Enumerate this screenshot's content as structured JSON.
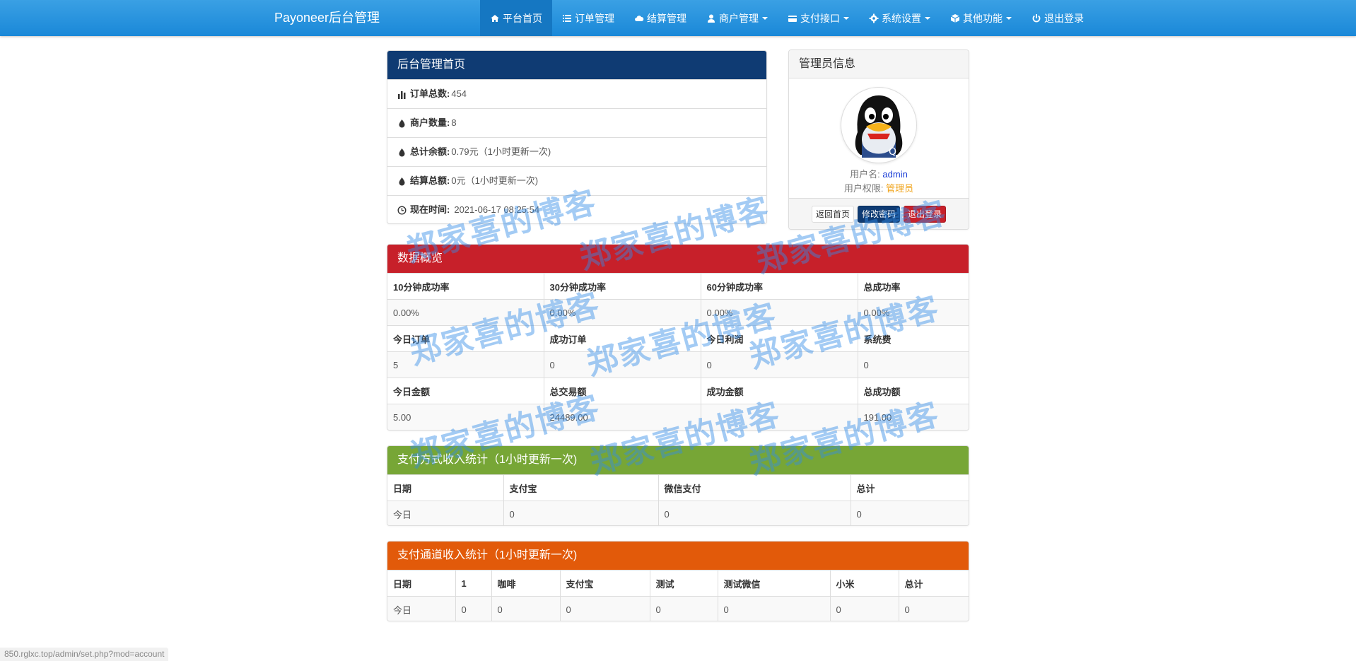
{
  "navbar": {
    "brand": "Payoneer后台管理",
    "items": [
      {
        "label": "平台首页",
        "icon": "home-icon",
        "dropdown": false,
        "active": true
      },
      {
        "label": "订单管理",
        "icon": "list-icon",
        "dropdown": false,
        "active": false
      },
      {
        "label": "结算管理",
        "icon": "cloud-icon",
        "dropdown": false,
        "active": false
      },
      {
        "label": "商户管理",
        "icon": "user-icon",
        "dropdown": true,
        "active": false
      },
      {
        "label": "支付接口",
        "icon": "credit-card-icon",
        "dropdown": true,
        "active": false
      },
      {
        "label": "系统设置",
        "icon": "gear-icon",
        "dropdown": true,
        "active": false
      },
      {
        "label": "其他功能",
        "icon": "cube-icon",
        "dropdown": true,
        "active": false
      },
      {
        "label": "退出登录",
        "icon": "power-icon",
        "dropdown": false,
        "active": false
      }
    ]
  },
  "home_panel": {
    "title": "后台管理首页",
    "rows": [
      {
        "icon": "bar-chart-icon",
        "label": "订单总数:",
        "value": "454"
      },
      {
        "icon": "drop-icon",
        "label": "商户数量:",
        "value": "8"
      },
      {
        "icon": "drop-icon",
        "label": "总计余额:",
        "value": "0.79元（1小时更新一次)"
      },
      {
        "icon": "drop-icon",
        "label": "结算总额:",
        "value": "0元（1小时更新一次)"
      },
      {
        "icon": "clock-icon",
        "label": "现在时间:",
        "value": "2021-06-17 08:25:54"
      }
    ]
  },
  "admin_panel": {
    "title": "管理员信息",
    "username_label": "用户名:",
    "username": "admin",
    "role_label": "用户权限:",
    "role": "管理员",
    "buttons": {
      "home": "返回首页",
      "change_password": "修改密码",
      "logout": "退出登录"
    }
  },
  "overview_panel": {
    "title": "数据概览",
    "rows": [
      {
        "headers": [
          "10分钟成功率",
          "30分钟成功率",
          "60分钟成功率",
          "总成功率"
        ],
        "values": [
          "0.00%",
          "0.00%",
          "0.00%",
          "0.00%"
        ]
      },
      {
        "headers": [
          "今日订单",
          "成功订单",
          "今日利润",
          "系统费"
        ],
        "values": [
          "5",
          "0",
          "0",
          "0"
        ]
      },
      {
        "headers": [
          "今日金额",
          "总交易额",
          "成功金额",
          "总成功额"
        ],
        "values": [
          "5.00",
          "24489.00",
          "",
          "191.00"
        ]
      }
    ]
  },
  "paymethod_panel": {
    "title": "支付方式收入统计（1小时更新一次)",
    "headers": [
      "日期",
      "支付宝",
      "微信支付",
      "总计"
    ],
    "values": [
      "今日",
      "0",
      "0",
      "0"
    ]
  },
  "channel_panel": {
    "title": "支付通道收入统计（1小时更新一次)",
    "headers": [
      "日期",
      "1",
      "咖啡",
      "支付宝",
      "测试",
      "测试微信",
      "小米",
      "总计"
    ],
    "values": [
      "今日",
      "0",
      "0",
      "0",
      "0",
      "0",
      "0",
      "0"
    ]
  },
  "watermark_text": "郑家喜的博客",
  "status_bar": "850.rglxc.top/admin/set.php?mod=account",
  "colors": {
    "navbar": "#1a88d8",
    "home_heading": "#0f3b73",
    "overview_heading": "#c7202a",
    "paymethod_heading": "#77a636",
    "channel_heading": "#e25a0a"
  }
}
